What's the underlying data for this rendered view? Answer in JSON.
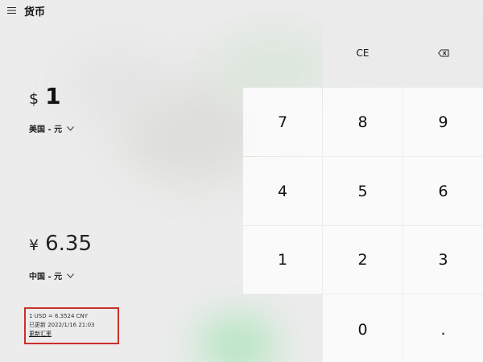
{
  "app": {
    "title": "货币"
  },
  "from": {
    "symbol": "$",
    "value": "1",
    "currency": "美国 - 元"
  },
  "to": {
    "symbol": "¥",
    "value": "6.35",
    "currency": "中国 - 元"
  },
  "rate": {
    "line1": "1 USD = 6.3524 CNY",
    "updated": "已更新 2022/1/16 21:03",
    "link": "更新汇率"
  },
  "keypad": {
    "clear": "CE",
    "backspace_icon": "backspace-icon",
    "keys": [
      "7",
      "8",
      "9",
      "4",
      "5",
      "6",
      "1",
      "2",
      "3",
      "0",
      "."
    ]
  },
  "colors": {
    "highlight_border": "#c9302c"
  }
}
